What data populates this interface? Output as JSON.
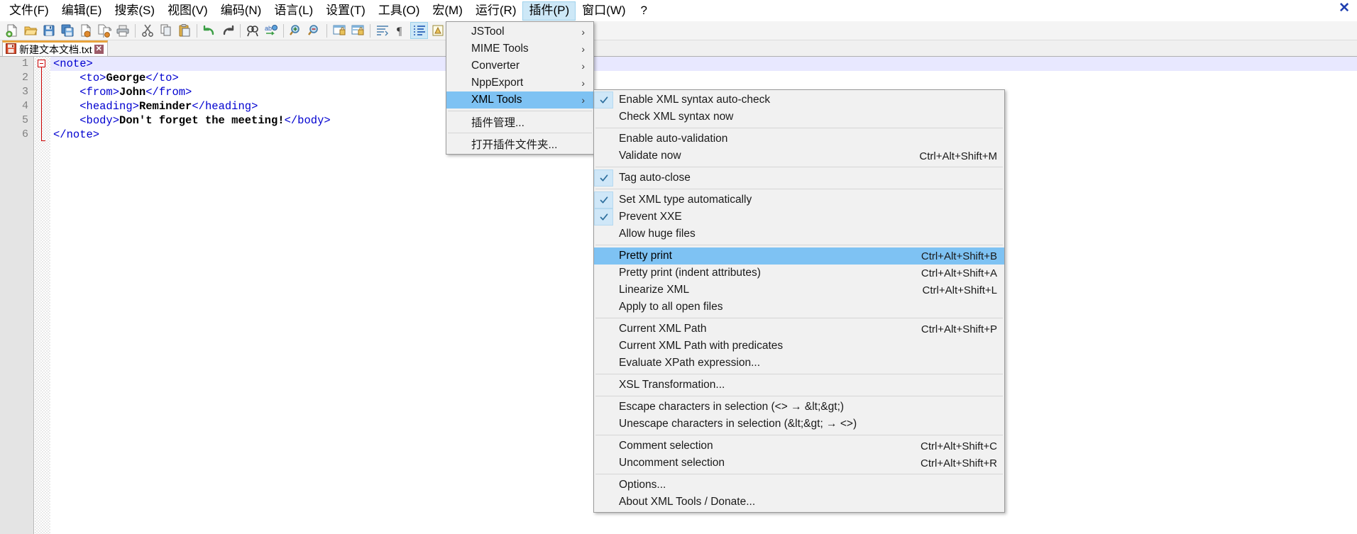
{
  "window": {
    "close_label": "✕"
  },
  "menubar": {
    "items": [
      {
        "label": "文件(F)",
        "active": false
      },
      {
        "label": "编辑(E)",
        "active": false
      },
      {
        "label": "搜索(S)",
        "active": false
      },
      {
        "label": "视图(V)",
        "active": false
      },
      {
        "label": "编码(N)",
        "active": false
      },
      {
        "label": "语言(L)",
        "active": false
      },
      {
        "label": "设置(T)",
        "active": false
      },
      {
        "label": "工具(O)",
        "active": false
      },
      {
        "label": "宏(M)",
        "active": false
      },
      {
        "label": "运行(R)",
        "active": false
      },
      {
        "label": "插件(P)",
        "active": true
      },
      {
        "label": "窗口(W)",
        "active": false
      },
      {
        "label": "?",
        "active": false
      }
    ]
  },
  "toolbar": {
    "buttons": [
      {
        "name": "new-file-icon"
      },
      {
        "name": "open-file-icon"
      },
      {
        "name": "save-icon"
      },
      {
        "name": "save-all-icon"
      },
      {
        "name": "close-file-icon"
      },
      {
        "name": "close-all-files-icon"
      },
      {
        "name": "print-icon"
      },
      {
        "name": "separator"
      },
      {
        "name": "cut-icon"
      },
      {
        "name": "copy-icon"
      },
      {
        "name": "paste-icon"
      },
      {
        "name": "separator"
      },
      {
        "name": "undo-icon"
      },
      {
        "name": "redo-icon"
      },
      {
        "name": "separator"
      },
      {
        "name": "find-icon"
      },
      {
        "name": "replace-icon"
      },
      {
        "name": "separator"
      },
      {
        "name": "zoom-in-icon"
      },
      {
        "name": "zoom-out-icon"
      },
      {
        "name": "separator"
      },
      {
        "name": "sync-vertical-scroll-icon"
      },
      {
        "name": "sync-horizontal-scroll-icon"
      },
      {
        "name": "separator"
      },
      {
        "name": "word-wrap-icon"
      },
      {
        "name": "show-all-chars-icon"
      },
      {
        "name": "indent-guide-icon"
      },
      {
        "name": "ui-user-defined-dialog-icon"
      },
      {
        "name": "separator"
      },
      {
        "name": "show-doc-map-icon"
      },
      {
        "name": "function-list-icon"
      },
      {
        "name": "separator"
      },
      {
        "name": "folder-as-workspace-icon"
      }
    ]
  },
  "tabs": [
    {
      "label": "新建文本文档.txt",
      "close": "✕",
      "active": true
    }
  ],
  "editor": {
    "lines": [
      {
        "num": "1",
        "indent": 0,
        "parts": [
          {
            "t": "tag",
            "s": "<note>"
          }
        ]
      },
      {
        "num": "2",
        "indent": 4,
        "parts": [
          {
            "t": "tag",
            "s": "<to>"
          },
          {
            "t": "val",
            "s": "George"
          },
          {
            "t": "tag",
            "s": "</to>"
          }
        ]
      },
      {
        "num": "3",
        "indent": 4,
        "parts": [
          {
            "t": "tag",
            "s": "<from>"
          },
          {
            "t": "val",
            "s": "John"
          },
          {
            "t": "tag",
            "s": "</from>"
          }
        ]
      },
      {
        "num": "4",
        "indent": 4,
        "parts": [
          {
            "t": "tag",
            "s": "<heading>"
          },
          {
            "t": "val",
            "s": "Reminder"
          },
          {
            "t": "tag",
            "s": "</heading>"
          }
        ]
      },
      {
        "num": "5",
        "indent": 4,
        "parts": [
          {
            "t": "tag",
            "s": "<body>"
          },
          {
            "t": "val",
            "s": "Don't forget the meeting!"
          },
          {
            "t": "tag",
            "s": "</body>"
          }
        ]
      },
      {
        "num": "6",
        "indent": 0,
        "parts": [
          {
            "t": "tag",
            "s": "</note>"
          }
        ]
      }
    ]
  },
  "plugins_menu": {
    "items": [
      {
        "label": "JSTool",
        "submenu": true,
        "highlight": false
      },
      {
        "label": "MIME Tools",
        "submenu": true,
        "highlight": false
      },
      {
        "label": "Converter",
        "submenu": true,
        "highlight": false
      },
      {
        "label": "NppExport",
        "submenu": true,
        "highlight": false
      },
      {
        "label": "XML Tools",
        "submenu": true,
        "highlight": true
      },
      {
        "separator": true
      },
      {
        "label": "插件管理...",
        "submenu": false,
        "highlight": false
      },
      {
        "separator": true
      },
      {
        "label": "打开插件文件夹...",
        "submenu": false,
        "highlight": false
      }
    ]
  },
  "xmltools_menu": {
    "items": [
      {
        "label": "Enable XML syntax auto-check",
        "checked": true,
        "accel": "",
        "highlight": false
      },
      {
        "label": "Check XML syntax now",
        "checked": false,
        "accel": "",
        "highlight": false
      },
      {
        "separator": true
      },
      {
        "label": "Enable auto-validation",
        "checked": false,
        "accel": "",
        "highlight": false
      },
      {
        "label": "Validate now",
        "checked": false,
        "accel": "Ctrl+Alt+Shift+M",
        "highlight": false
      },
      {
        "separator": true
      },
      {
        "label": "Tag auto-close",
        "checked": true,
        "accel": "",
        "highlight": false
      },
      {
        "separator": true
      },
      {
        "label": "Set XML type automatically",
        "checked": true,
        "accel": "",
        "highlight": false
      },
      {
        "label": "Prevent XXE",
        "checked": true,
        "accel": "",
        "highlight": false
      },
      {
        "label": "Allow huge files",
        "checked": false,
        "accel": "",
        "highlight": false
      },
      {
        "separator": true
      },
      {
        "label": "Pretty print",
        "checked": false,
        "accel": "Ctrl+Alt+Shift+B",
        "highlight": true
      },
      {
        "label": "Pretty print (indent attributes)",
        "checked": false,
        "accel": "Ctrl+Alt+Shift+A",
        "highlight": false
      },
      {
        "label": "Linearize XML",
        "checked": false,
        "accel": "Ctrl+Alt+Shift+L",
        "highlight": false
      },
      {
        "label": "Apply to all open files",
        "checked": false,
        "accel": "",
        "highlight": false
      },
      {
        "separator": true
      },
      {
        "label": "Current XML Path",
        "checked": false,
        "accel": "Ctrl+Alt+Shift+P",
        "highlight": false
      },
      {
        "label": "Current XML Path with predicates",
        "checked": false,
        "accel": "",
        "highlight": false
      },
      {
        "label": "Evaluate XPath expression...",
        "checked": false,
        "accel": "",
        "highlight": false
      },
      {
        "separator": true
      },
      {
        "label": "XSL Transformation...",
        "checked": false,
        "accel": "",
        "highlight": false
      },
      {
        "separator": true
      },
      {
        "label": "Escape characters in selection (<> → &lt;&gt;)",
        "checked": false,
        "accel": "",
        "highlight": false
      },
      {
        "label": "Unescape characters in selection (&lt;&gt; → <>)",
        "checked": false,
        "accel": "",
        "highlight": false
      },
      {
        "separator": true
      },
      {
        "label": "Comment selection",
        "checked": false,
        "accel": "Ctrl+Alt+Shift+C",
        "highlight": false
      },
      {
        "label": "Uncomment selection",
        "checked": false,
        "accel": "Ctrl+Alt+Shift+R",
        "highlight": false
      },
      {
        "separator": true
      },
      {
        "label": "Options...",
        "checked": false,
        "accel": "",
        "highlight": false
      },
      {
        "label": "About XML Tools / Donate...",
        "checked": false,
        "accel": "",
        "highlight": false
      }
    ]
  },
  "colors": {
    "menu_highlight": "#7ec2f3",
    "menu_bg": "#f1f1f1",
    "toolbar_bg": "#f4f4f4",
    "tab_accent": "#e8a33d",
    "tag_color": "#0000d0",
    "gutter_bg": "#e4e4e4",
    "caret_line": "#e8e8ff",
    "fold_marker": "#cc0000"
  }
}
